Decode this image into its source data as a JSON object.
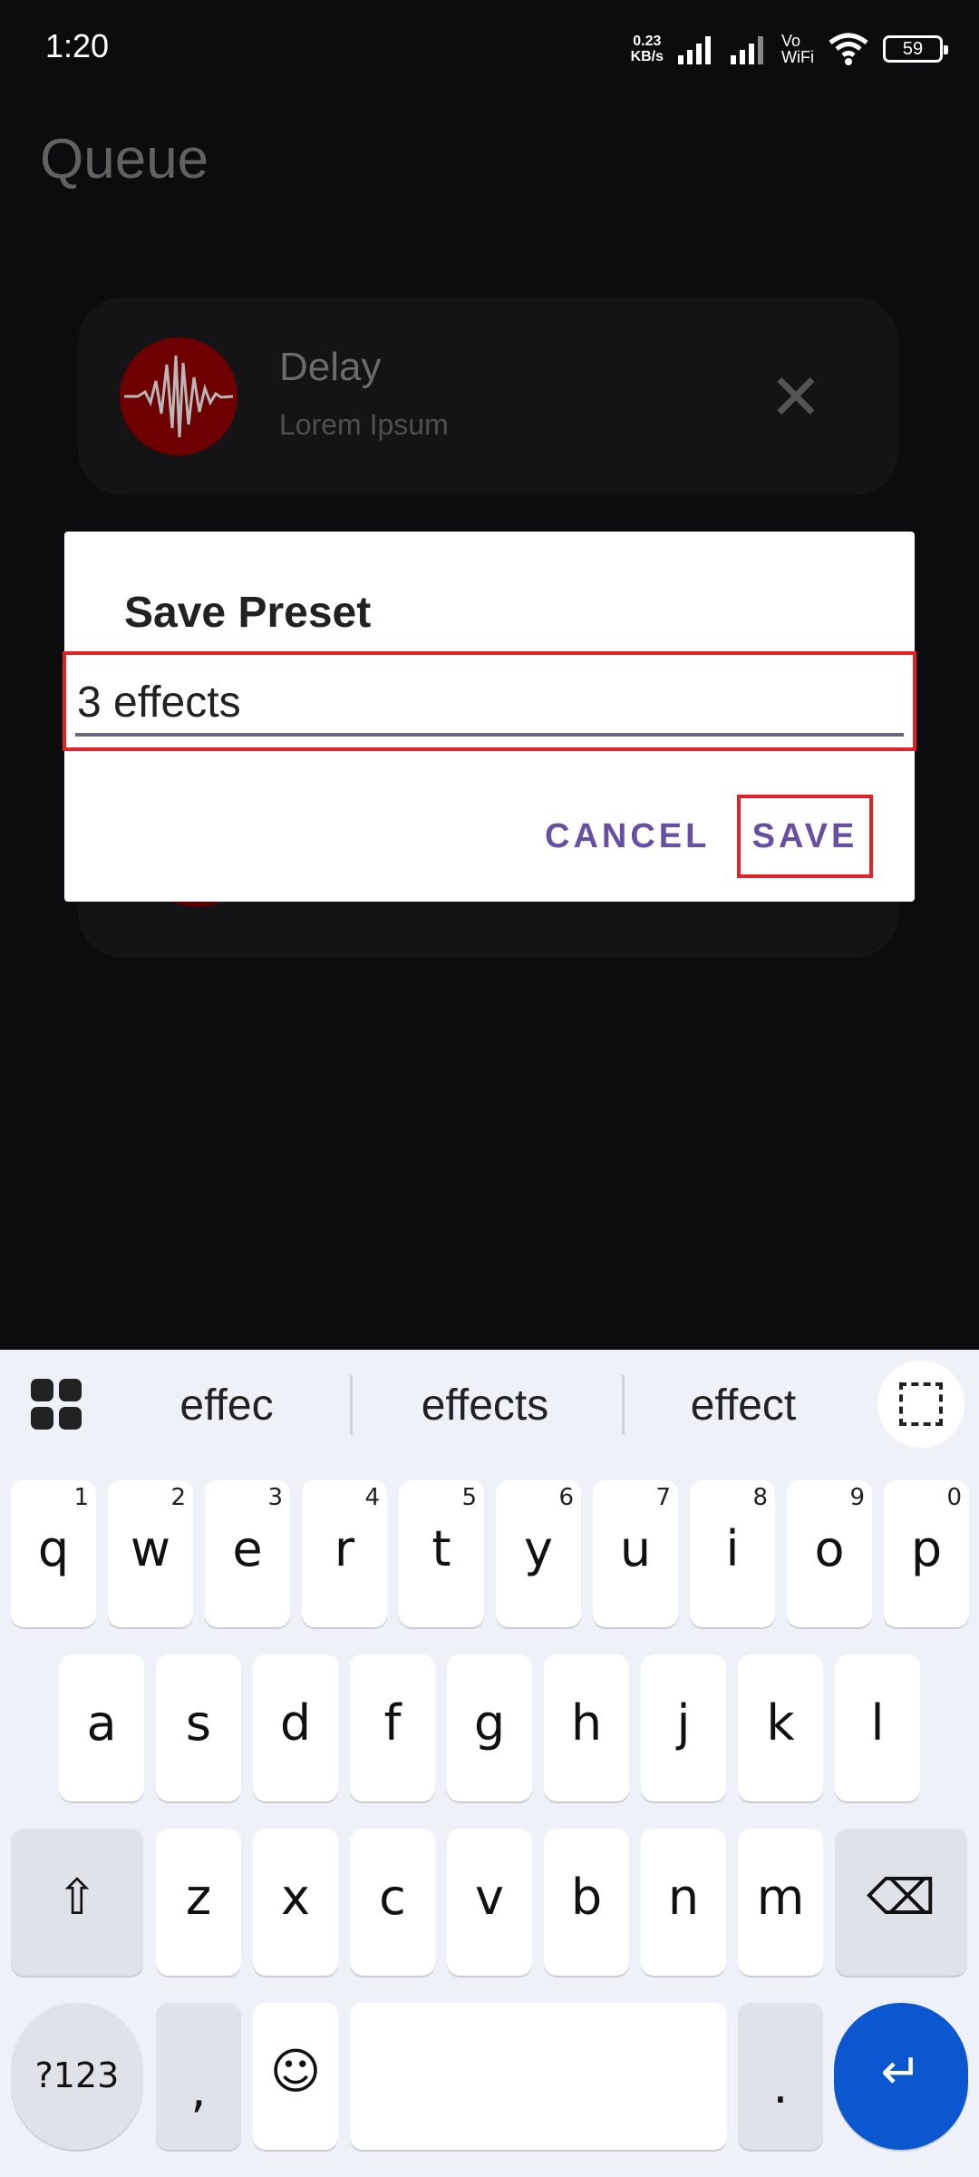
{
  "status_bar": {
    "time": "1:20",
    "net_speed_value": "0.23",
    "net_speed_unit": "KB/s",
    "vo_label": "Vo",
    "wifi_label": "WiFi",
    "battery": "59"
  },
  "page": {
    "title": "Queue",
    "queue_items": [
      {
        "title": "Delay",
        "subtitle": "Lorem Ipsum"
      }
    ]
  },
  "dialog": {
    "title": "Save Preset",
    "input_value": "3 effects",
    "cancel_label": "CANCEL",
    "save_label": "SAVE"
  },
  "keyboard": {
    "suggestions": [
      "effec",
      "effects",
      "effect"
    ],
    "row1": [
      {
        "ch": "q",
        "num": "1"
      },
      {
        "ch": "w",
        "num": "2"
      },
      {
        "ch": "e",
        "num": "3"
      },
      {
        "ch": "r",
        "num": "4"
      },
      {
        "ch": "t",
        "num": "5"
      },
      {
        "ch": "y",
        "num": "6"
      },
      {
        "ch": "u",
        "num": "7"
      },
      {
        "ch": "i",
        "num": "8"
      },
      {
        "ch": "o",
        "num": "9"
      },
      {
        "ch": "p",
        "num": "0"
      }
    ],
    "row2": [
      "a",
      "s",
      "d",
      "f",
      "g",
      "h",
      "j",
      "k",
      "l"
    ],
    "row3": [
      "z",
      "x",
      "c",
      "v",
      "b",
      "n",
      "m"
    ],
    "symbols_label": "?123",
    "comma_label": ",",
    "period_label": ".",
    "shift_icon": "⇧",
    "backspace_icon": "⌫",
    "emoji_icon": "☺",
    "enter_icon": "↵"
  },
  "colors": {
    "accent": "#6750a4",
    "highlight": "#e32127",
    "enter": "#0b57d0"
  }
}
